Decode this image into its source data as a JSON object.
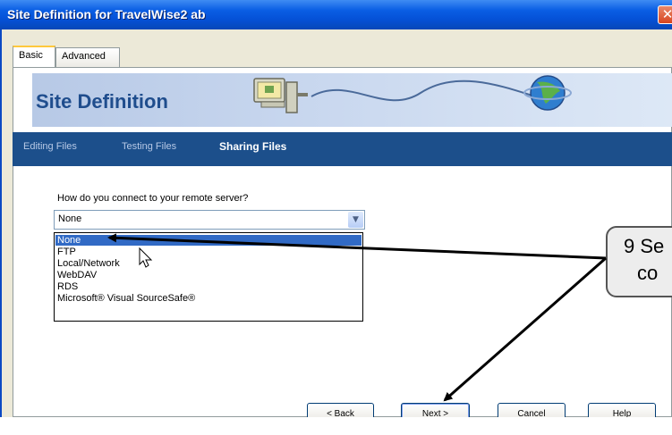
{
  "window": {
    "title": "Site Definition for TravelWise2 ab",
    "close_glyph": "✕"
  },
  "tabs": [
    {
      "label": "Basic",
      "active": true
    },
    {
      "label": "Advanced",
      "active": false
    }
  ],
  "banner": {
    "title": "Site Definition"
  },
  "subnav": [
    {
      "label": "Editing Files",
      "active": false
    },
    {
      "label": "Testing Files",
      "active": false
    },
    {
      "label": "Sharing Files",
      "active": true
    }
  ],
  "form": {
    "prompt": "How do you connect to your remote server?",
    "selected_value": "None",
    "options": [
      "None",
      "FTP",
      "Local/Network",
      "WebDAV",
      "RDS",
      "Microsoft® Visual SourceSafe®"
    ],
    "highlighted_index": 0
  },
  "buttons": {
    "back": "< Back",
    "next": "Next >",
    "cancel": "Cancel",
    "help": "Help"
  },
  "callout": {
    "line1": "9  Se",
    "line2": "co"
  },
  "colors": {
    "titlebar": "#0a5ee4",
    "banner": "#c7d6ee",
    "subnav": "#1c4f8b",
    "selection": "#316ac5"
  },
  "icons": {
    "computer": "computer-icon",
    "globe": "globe-icon",
    "cursor": "mouse-pointer-icon",
    "dropdown": "chevron-down-icon"
  }
}
